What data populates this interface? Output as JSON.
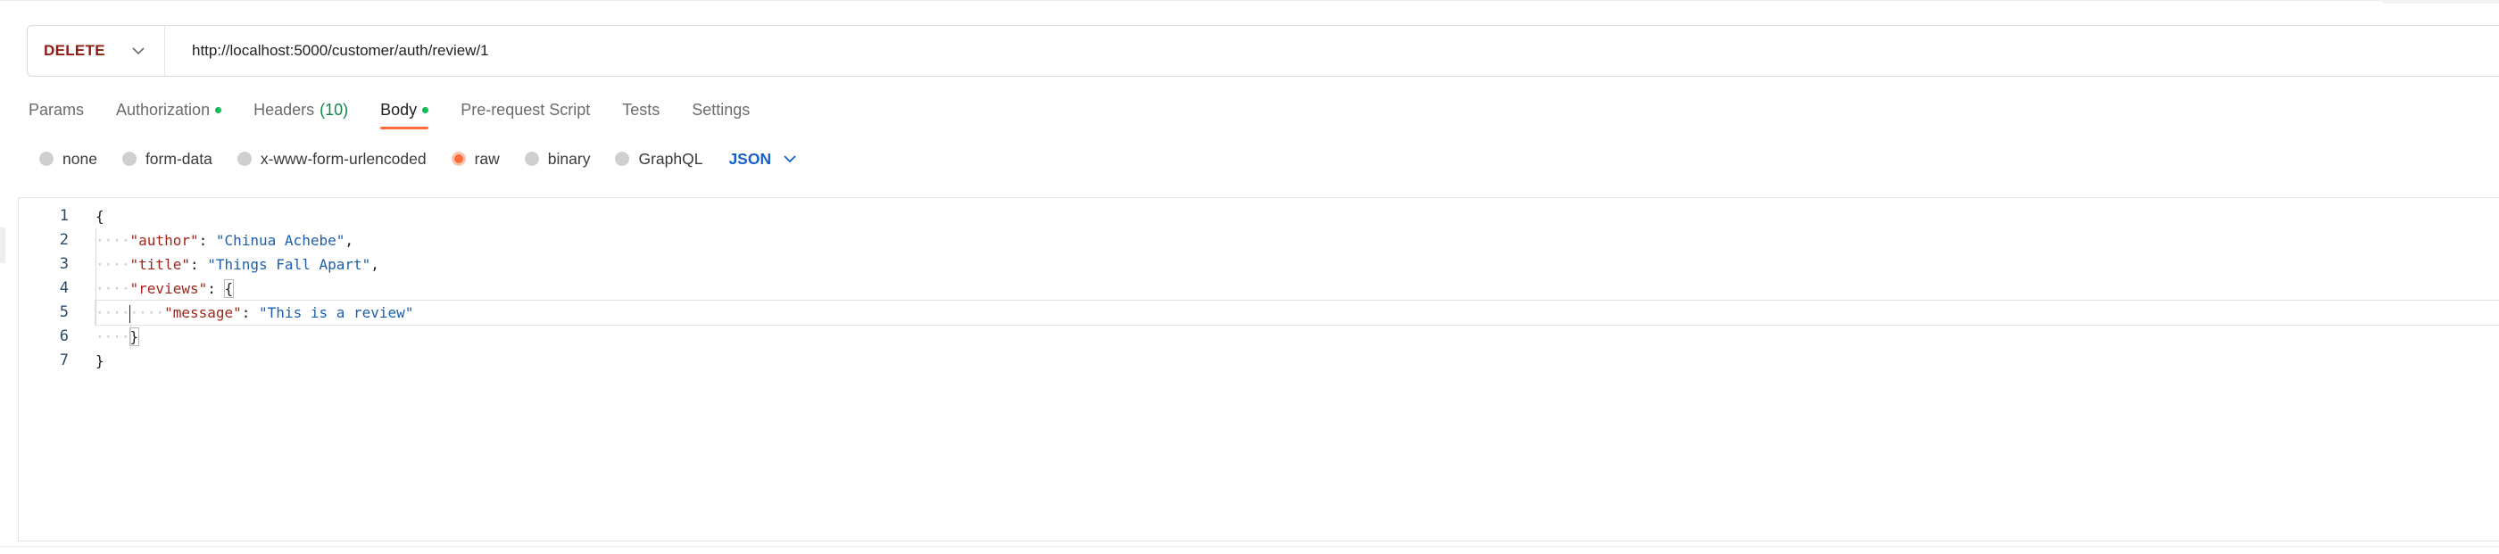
{
  "request": {
    "method": "DELETE",
    "url": "http://localhost:5000/customer/auth/review/1"
  },
  "tabs": [
    {
      "label": "Params",
      "count": "",
      "dot": false,
      "active": false
    },
    {
      "label": "Authorization",
      "count": "",
      "dot": true,
      "active": false
    },
    {
      "label": "Headers",
      "count": "(10)",
      "dot": false,
      "active": false
    },
    {
      "label": "Body",
      "count": "",
      "dot": true,
      "active": true
    },
    {
      "label": "Pre-request Script",
      "count": "",
      "dot": false,
      "active": false
    },
    {
      "label": "Tests",
      "count": "",
      "dot": false,
      "active": false
    },
    {
      "label": "Settings",
      "count": "",
      "dot": false,
      "active": false
    }
  ],
  "body_types": [
    {
      "label": "none",
      "selected": false
    },
    {
      "label": "form-data",
      "selected": false
    },
    {
      "label": "x-www-form-urlencoded",
      "selected": false
    },
    {
      "label": "raw",
      "selected": true
    },
    {
      "label": "binary",
      "selected": false
    },
    {
      "label": "GraphQL",
      "selected": false
    }
  ],
  "raw_format": "JSON",
  "editor": {
    "line_numbers": [
      "1",
      "2",
      "3",
      "4",
      "5",
      "6",
      "7"
    ],
    "current_line": 5,
    "lines": [
      [
        {
          "t": "punc",
          "v": "{"
        }
      ],
      [
        {
          "t": "ws",
          "v": "····"
        },
        {
          "t": "key",
          "v": "\"author\""
        },
        {
          "t": "punc",
          "v": ": "
        },
        {
          "t": "str",
          "v": "\"Chinua Achebe\""
        },
        {
          "t": "punc",
          "v": ","
        }
      ],
      [
        {
          "t": "ws",
          "v": "····"
        },
        {
          "t": "key",
          "v": "\"title\""
        },
        {
          "t": "punc",
          "v": ": "
        },
        {
          "t": "str",
          "v": "\"Things Fall Apart\""
        },
        {
          "t": "punc",
          "v": ","
        }
      ],
      [
        {
          "t": "ws",
          "v": "····"
        },
        {
          "t": "key",
          "v": "\"reviews\""
        },
        {
          "t": "punc",
          "v": ": "
        },
        {
          "t": "bracket",
          "v": "{"
        }
      ],
      [
        {
          "t": "ws",
          "v": "····"
        },
        {
          "t": "caret",
          "v": ""
        },
        {
          "t": "ws",
          "v": "····"
        },
        {
          "t": "key",
          "v": "\"message\""
        },
        {
          "t": "punc",
          "v": ": "
        },
        {
          "t": "str",
          "v": "\"This is a review\""
        }
      ],
      [
        {
          "t": "ws",
          "v": "····"
        },
        {
          "t": "bracket",
          "v": "}"
        }
      ],
      [
        {
          "t": "punc",
          "v": "}"
        }
      ]
    ]
  },
  "icons": {
    "method_dropdown": "chevron-down-icon",
    "format_dropdown": "chevron-down-icon"
  },
  "colors": {
    "accent": "#ff6c37",
    "method": "#8e1a10",
    "json_key": "#a3261b",
    "json_string": "#1e5fad",
    "status_dot": "#0cbb52",
    "format_link": "#1860c9"
  }
}
